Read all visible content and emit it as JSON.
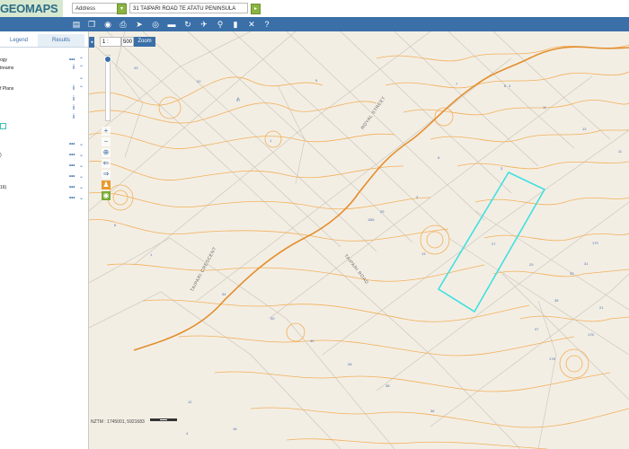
{
  "header": {
    "logo_text": "GEOMAPS",
    "search_type": "Address",
    "search_value": "31 TAIPARI ROAD TE ATATU PENINSULA",
    "dropdown_arrow": "▾",
    "go_arrow": "▸"
  },
  "toolbar": {
    "tools": [
      "layers-icon",
      "copy-icon",
      "eye-icon",
      "print-icon",
      "pointer-icon",
      "target-icon",
      "measure-icon",
      "refresh-icon",
      "walker-icon",
      "pin-icon",
      "bookmark-icon",
      "tools-icon",
      "help-icon"
    ]
  },
  "left_panel": {
    "tabs": {
      "legend": "Legend",
      "results": "Results"
    },
    "rows": [
      {
        "label": "ogy"
      },
      {
        "label": "treams"
      },
      {
        "label": "f Plans"
      },
      {
        "label": ""
      },
      {
        "label": ")"
      },
      {
        "label": ""
      },
      {
        "label": ""
      },
      {
        "label": "16)"
      },
      {
        "label": ""
      }
    ],
    "more": "•••",
    "chevron_up": "⌃",
    "chevron_down": "⌄",
    "info": "i"
  },
  "map": {
    "scale_prefix": "1 :",
    "scale_value": "500",
    "zoom_label": "Zoom",
    "collapse_arrow": "◂",
    "coords_text": "NZTM : 1745001, 5921683",
    "roads": [
      {
        "name": "TAIPARI ROAD"
      },
      {
        "name": "TAIPARI CRESCENT"
      },
      {
        "name": "ROYAL STREET"
      }
    ],
    "lot_numbers": [
      "43",
      "9",
      "6",
      "57",
      "4",
      "3",
      "7",
      "8",
      "11",
      "13",
      "11",
      "1",
      "5",
      "15",
      "3",
      "11",
      "13",
      "25",
      "27",
      "29",
      "31",
      "33",
      "35",
      "37",
      "170",
      "1",
      "21",
      "176",
      "178",
      "28",
      "30",
      "40",
      "38",
      "36",
      "34",
      "6",
      "12",
      "16",
      "22",
      "4"
    ],
    "highlight_color": "#40e0e0",
    "contour_color": "#f3b15a",
    "nav": {
      "plus": "+",
      "minus": "−",
      "globe": "⊕",
      "back": "⇐",
      "forward": "⇒"
    }
  }
}
